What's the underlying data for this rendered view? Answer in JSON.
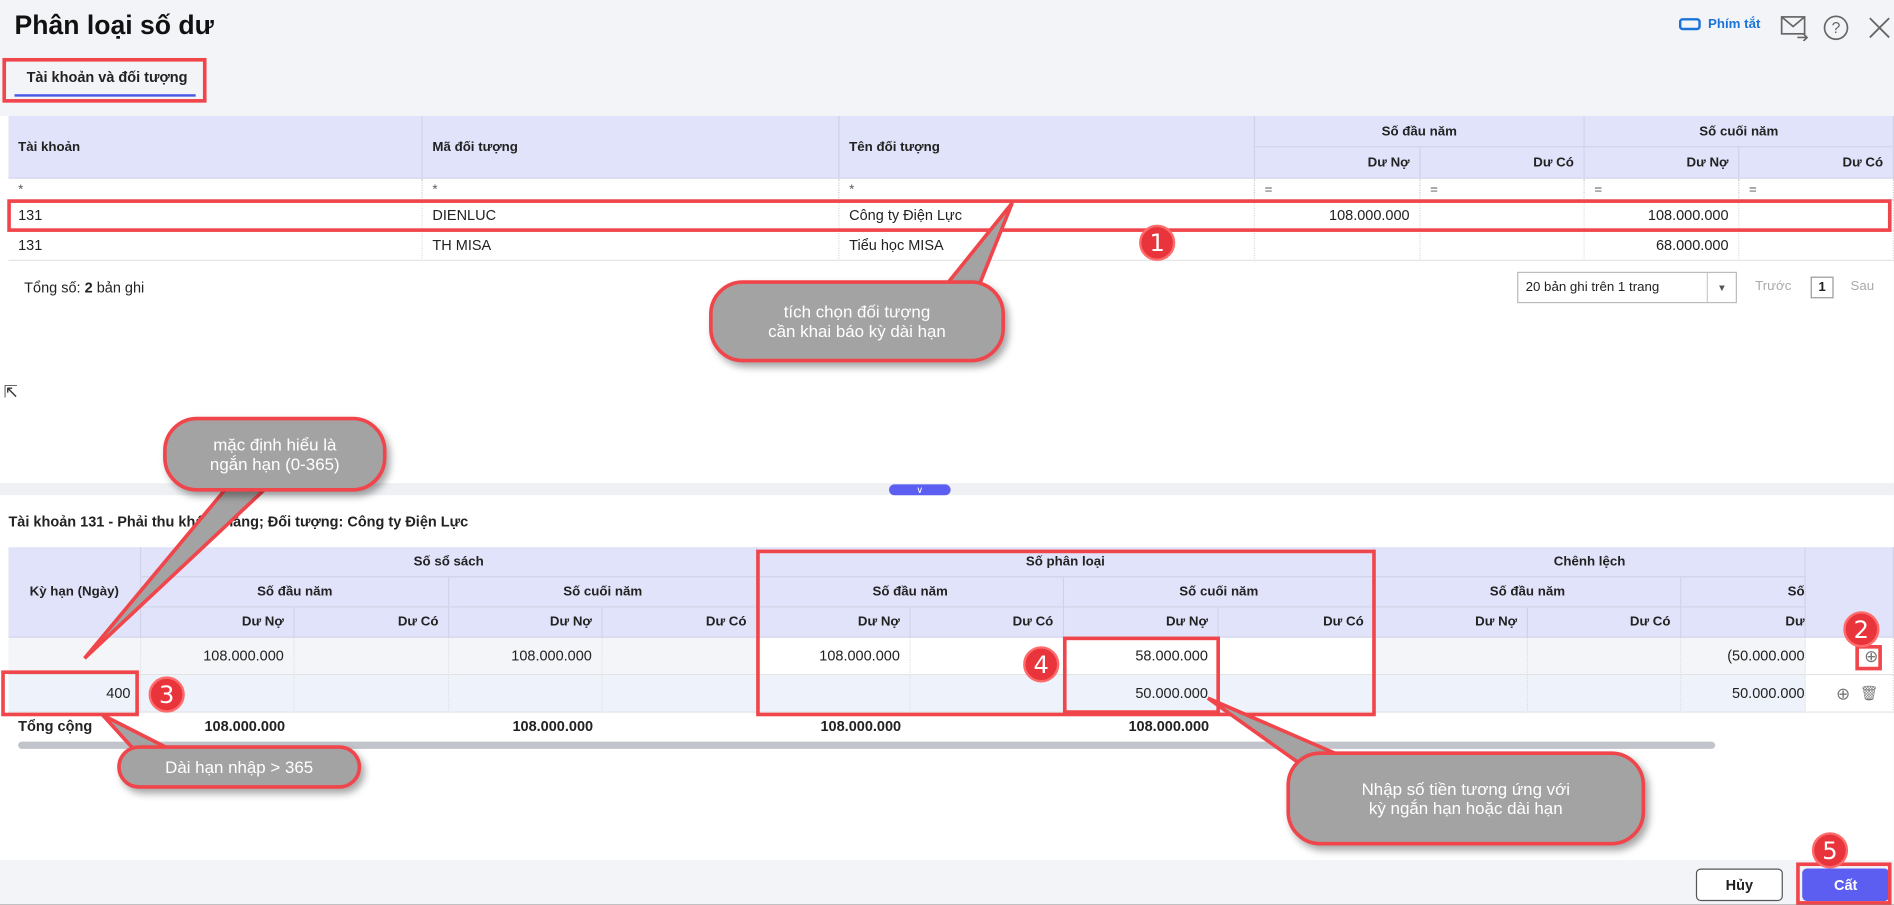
{
  "header": {
    "title": "Phân loại số dư",
    "shortcut_label": "Phím tắt",
    "icons": [
      "keyboard-icon",
      "mail-forward-icon",
      "help-icon",
      "close-icon"
    ]
  },
  "tabs": [
    {
      "label": "Tài khoản và đối tượng",
      "active": true
    }
  ],
  "top_table": {
    "columns": {
      "account": "Tài khoản",
      "object_code": "Mã đối tượng",
      "object_name": "Tên đối tượng",
      "opening": "Số đầu năm",
      "closing": "Số cuối năm",
      "debit": "Dư Nợ",
      "credit": "Dư Có"
    },
    "filters": {
      "text": "*",
      "number": "="
    },
    "rows": [
      {
        "account": "131",
        "object_code": "DIENLUC",
        "object_name": "Công ty Điện Lực",
        "open_debit": "108.000.000",
        "open_credit": "",
        "close_debit": "108.000.000",
        "close_credit": ""
      },
      {
        "account": "131",
        "object_code": "TH MISA",
        "object_name": "Tiểu học MISA",
        "open_debit": "",
        "open_credit": "",
        "close_debit": "68.000.000",
        "close_credit": ""
      }
    ],
    "total_prefix": "Tổng số: ",
    "total_count": "2",
    "total_suffix": " bản ghi",
    "page_size": "20 bản ghi trên 1 trang",
    "prev": "Trước",
    "page": "1",
    "next": "Sau"
  },
  "detail": {
    "title": "Tài khoản 131 - Phải thu khách hàng; Đối tượng: Công ty Điện Lực",
    "columns": {
      "term": "Kỳ hạn (Ngày)",
      "book": "Số sổ sách",
      "classified": "Số phân loại",
      "diff": "Chênh lệch",
      "opening": "Số đầu năm",
      "closing": "Số cuối năm",
      "closing_clipped": "Số",
      "debit": "Dư Nợ",
      "debit_clipped": "Dư",
      "credit": "Dư Có"
    },
    "rows": [
      {
        "term": "",
        "book_open_debit": "108.000.000",
        "book_open_credit": "",
        "book_close_debit": "108.000.000",
        "book_close_credit": "",
        "cls_open_debit": "108.000.000",
        "cls_open_credit": "",
        "cls_close_debit": "58.000.000",
        "cls_close_credit": "",
        "diff_open_debit": "",
        "diff_open_credit": "",
        "diff_close_debit": "(50.000.000"
      },
      {
        "term": "400",
        "book_open_debit": "",
        "book_open_credit": "",
        "book_close_debit": "",
        "book_close_credit": "",
        "cls_open_debit": "",
        "cls_open_credit": "",
        "cls_close_debit": "50.000.000",
        "cls_close_credit": "",
        "diff_open_debit": "",
        "diff_open_credit": "",
        "diff_close_debit": "50.000.000"
      }
    ],
    "total": {
      "label": "Tổng cộng",
      "book_open_debit": "108.000.000",
      "book_close_debit": "108.000.000",
      "cls_open_debit": "108.000.000",
      "cls_close_debit": "108.000.000"
    }
  },
  "footer": {
    "cancel": "Hủy",
    "save": "Cất"
  },
  "annotations": {
    "badges": [
      "1",
      "2",
      "3",
      "4",
      "5"
    ],
    "callout_select": "tích chọn đối tượng\ncần khai báo kỳ dài hạn",
    "callout_default": "mặc định hiểu là\nngắn hạn (0-365)",
    "callout_long": "Dài hạn nhập > 365",
    "callout_amount": "Nhập số tiền tương ứng với\nkỳ ngắn hạn hoặc dài hạn"
  },
  "colors": {
    "accent": "#5b5ef0",
    "header_bg": "#e1e3fa",
    "annotation_red": "#f0464b",
    "callout_gray": "#a3a3a3"
  }
}
